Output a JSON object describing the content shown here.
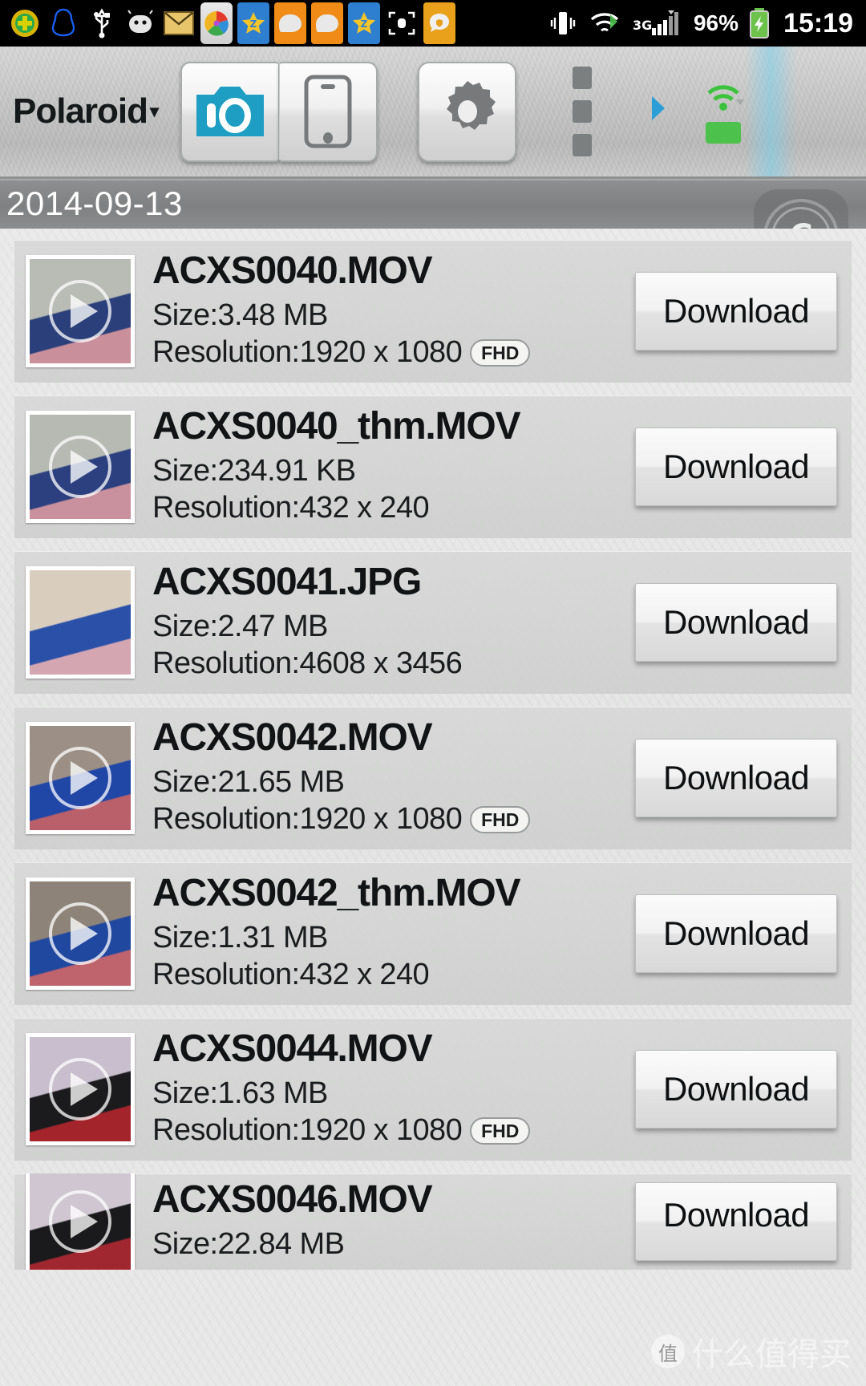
{
  "status_bar": {
    "notification_icons": [
      "green-plus-icon",
      "qq-penguin-icon",
      "usb-icon",
      "android-robot-icon",
      "email-icon",
      "photo-app-icon",
      "star-z-icon",
      "chat-bubble-icon",
      "chat-bubble-icon",
      "star-z-icon",
      "screenshot-icon",
      "security-chat-icon"
    ],
    "vibrate_icon": "vibrate-icon",
    "wifi_icon": "wifi-icon",
    "signal_label": "3G",
    "battery_percent": "96%",
    "battery_icon": "battery-charging-icon",
    "time": "15:19"
  },
  "toolbar": {
    "brand": "Polaroid",
    "brand_caret": "▾",
    "buttons": [
      {
        "name": "camera-tab",
        "icon": "camera-icon",
        "selected": true
      },
      {
        "name": "phone-tab",
        "icon": "phone-icon",
        "selected": false
      },
      {
        "name": "settings-button",
        "icon": "gear-icon",
        "selected": false
      }
    ],
    "overflow_icon": "vertical-dots-icon",
    "expand_icon": "right-caret-icon",
    "wifi_status_icon": "wifi-signal-icon",
    "battery_status_icon": "green-battery-icon",
    "accent_color": "#1f9ec4"
  },
  "date_header": {
    "date": "2014-09-13"
  },
  "brand_watermark": {
    "letter": "C"
  },
  "list": {
    "download_label": "Download",
    "items": [
      {
        "filename": "ACXS0040.MOV",
        "size": "Size:3.48 MB",
        "resolution": "Resolution:1920 x 1080",
        "badge": "FHD",
        "type": "video",
        "thumb_colors": [
          "#b9bcb4",
          "#2b3f7a",
          "#c98f9b"
        ]
      },
      {
        "filename": "ACXS0040_thm.MOV",
        "size": "Size:234.91 KB",
        "resolution": "Resolution:432 x 240",
        "badge": "",
        "type": "video",
        "thumb_colors": [
          "#b6bab2",
          "#2c4080",
          "#c9919d"
        ]
      },
      {
        "filename": "ACXS0041.JPG",
        "size": "Size:2.47 MB",
        "resolution": "Resolution:4608 x 3456",
        "badge": "",
        "type": "image",
        "thumb_colors": [
          "#d9cdbe",
          "#2a50a8",
          "#d4a6b2"
        ]
      },
      {
        "filename": "ACXS0042.MOV",
        "size": "Size:21.65 MB",
        "resolution": "Resolution:1920 x 1080",
        "badge": "FHD",
        "type": "video",
        "thumb_colors": [
          "#9c9086",
          "#2046a6",
          "#b9606a"
        ]
      },
      {
        "filename": "ACXS0042_thm.MOV",
        "size": "Size:1.31 MB",
        "resolution": "Resolution:432 x 240",
        "badge": "",
        "type": "video",
        "thumb_colors": [
          "#8e8379",
          "#21489f",
          "#bf636d"
        ]
      },
      {
        "filename": "ACXS0044.MOV",
        "size": "Size:1.63 MB",
        "resolution": "Resolution:1920 x 1080",
        "badge": "FHD",
        "type": "video",
        "thumb_colors": [
          "#c8becd",
          "#1b1b1d",
          "#a4242c"
        ]
      },
      {
        "filename": "ACXS0046.MOV",
        "size": "Size:22.84 MB",
        "resolution": "",
        "badge": "",
        "type": "video",
        "thumb_colors": [
          "#cfc6d2",
          "#1a1a1c",
          "#a02730"
        ]
      }
    ]
  },
  "page_watermark": {
    "symbol": "值",
    "text": "什么值得买"
  }
}
